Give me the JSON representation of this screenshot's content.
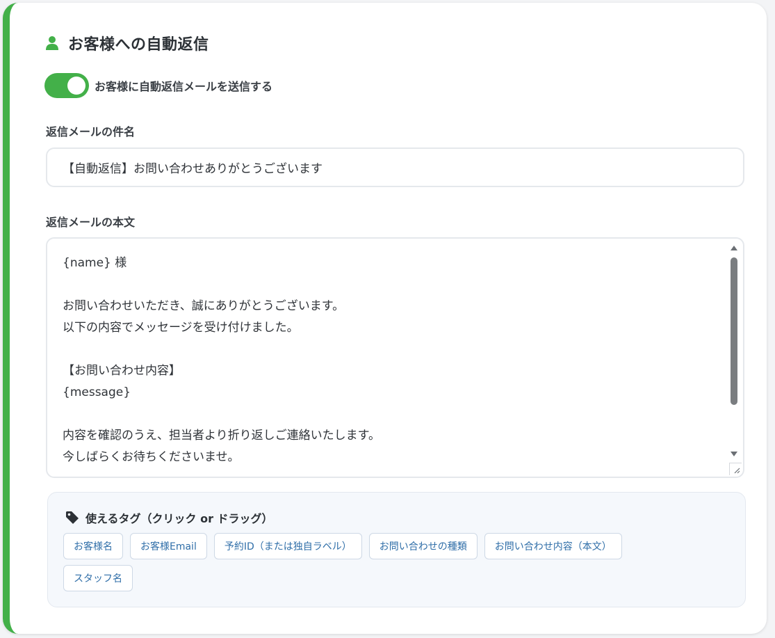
{
  "section": {
    "title": "お客様への自動返信",
    "icon": "user-icon"
  },
  "auto_reply_toggle": {
    "label": "お客様に自動返信メールを送信する",
    "checked": true,
    "color": "#43b049"
  },
  "subject": {
    "label": "返信メールの件名",
    "value": "【自動返信】お問い合わせありがとうございます"
  },
  "body": {
    "label": "返信メールの本文",
    "lines": [
      "{name} 様",
      "",
      "お問い合わせいただき、誠にありがとうございます。",
      "以下の内容でメッセージを受け付けました。",
      "",
      "【お問い合わせ内容】",
      "{message}",
      "",
      "内容を確認のうえ、担当者より折り返しご連絡いたします。",
      "今しばらくお待ちくださいませ。"
    ]
  },
  "tags": {
    "title": "使えるタグ（クリック or ドラッグ）",
    "icon": "tag-icon",
    "items": [
      "お客様名",
      "お客様Email",
      "予約ID（または独自ラベル）",
      "お問い合わせの種類",
      "お問い合わせ内容（本文）",
      "スタッフ名"
    ]
  },
  "colors": {
    "accent": "#43b049",
    "tag_text": "#2f6ea8"
  }
}
